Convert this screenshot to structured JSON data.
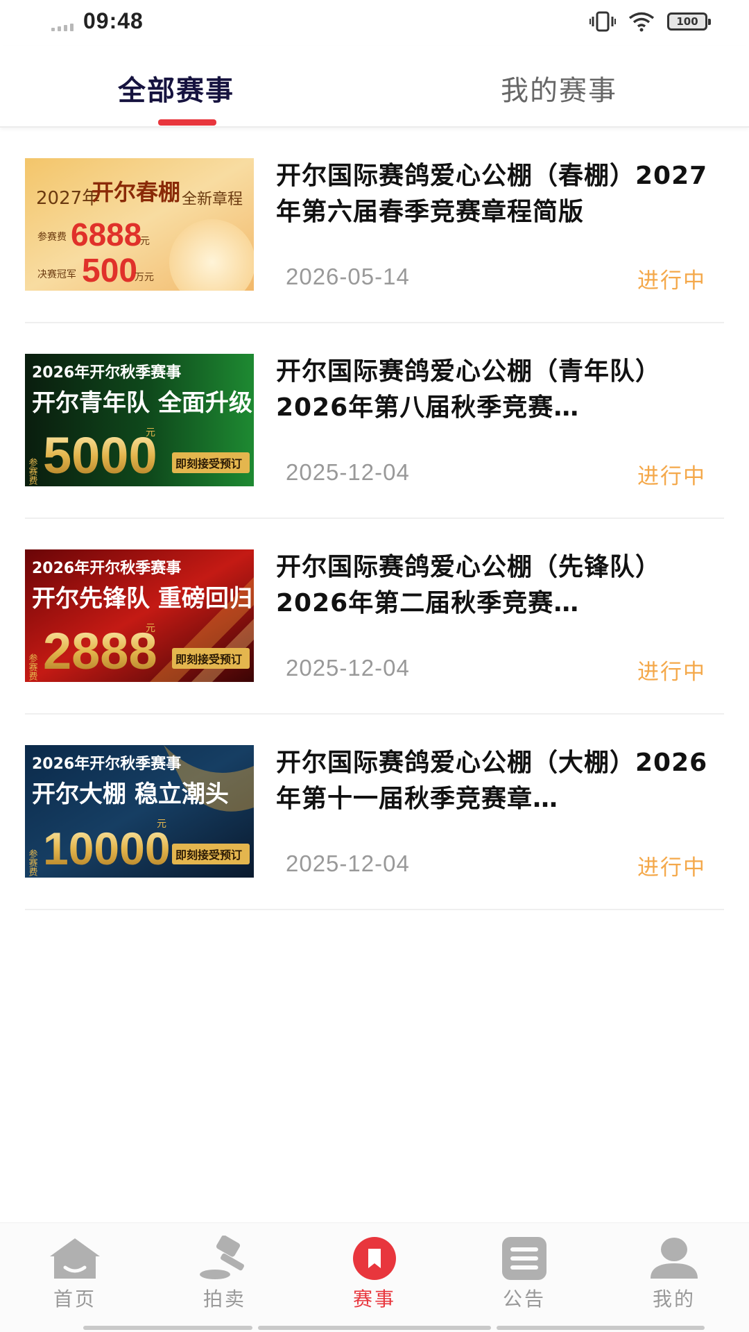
{
  "status_bar": {
    "time": "09:48",
    "battery": "100",
    "icons": [
      "signal-icon",
      "vibrate-icon",
      "wifi-icon",
      "battery-icon"
    ]
  },
  "tabs": [
    {
      "label": "全部赛事",
      "active": true
    },
    {
      "label": "我的赛事",
      "active": false
    }
  ],
  "events": [
    {
      "title": "开尔国际赛鸽爱心公棚（春棚）2027年第六届春季竞赛章程简版",
      "date": "2026-05-14",
      "status": "进行中",
      "banner": {
        "line1_year": "2027年",
        "line1_name": "开尔春棚",
        "line1_tag": "全新章程",
        "fee_label": "参赛费",
        "fee_value": "6888",
        "fee_unit": "元",
        "prize_label": "决赛冠军",
        "prize_value": "500",
        "prize_unit": "万元"
      }
    },
    {
      "title": "开尔国际赛鸽爱心公棚（青年队）2026年第八届秋季竞赛…",
      "date": "2025-12-04",
      "status": "进行中",
      "banner": {
        "line1": "2026年开尔秋季赛事",
        "line2": "开尔青年队 全面升级",
        "fee_label": "参赛费",
        "fee_value": "5000",
        "fee_unit": "元",
        "cta": "即刻接受预订"
      }
    },
    {
      "title": "开尔国际赛鸽爱心公棚（先锋队）2026年第二届秋季竞赛…",
      "date": "2025-12-04",
      "status": "进行中",
      "banner": {
        "line1": "2026年开尔秋季赛事",
        "line2": "开尔先锋队 重磅回归",
        "fee_label": "参赛费",
        "fee_value": "2888",
        "fee_unit": "元",
        "cta": "即刻接受预订"
      }
    },
    {
      "title": "开尔国际赛鸽爱心公棚（大棚）2026年第十一届秋季竞赛章…",
      "date": "2025-12-04",
      "status": "进行中",
      "banner": {
        "line1": "2026年开尔秋季赛事",
        "line2": "开尔大棚 稳立潮头",
        "fee_label": "参赛费",
        "fee_value": "10000",
        "fee_unit": "元",
        "cta": "即刻接受预订"
      }
    }
  ],
  "bottom_nav": [
    {
      "label": "首页",
      "icon": "home-icon",
      "active": false
    },
    {
      "label": "拍卖",
      "icon": "auction-hammer-icon",
      "active": false
    },
    {
      "label": "赛事",
      "icon": "bookmark-icon",
      "active": true
    },
    {
      "label": "公告",
      "icon": "notice-list-icon",
      "active": false
    },
    {
      "label": "我的",
      "icon": "user-icon",
      "active": false
    }
  ],
  "colors": {
    "accent_red": "#e8363d",
    "status_orange": "#f4a84a",
    "active_tab": "#16133f",
    "muted_gray": "#999999",
    "icon_gray": "#b0b0b0"
  }
}
